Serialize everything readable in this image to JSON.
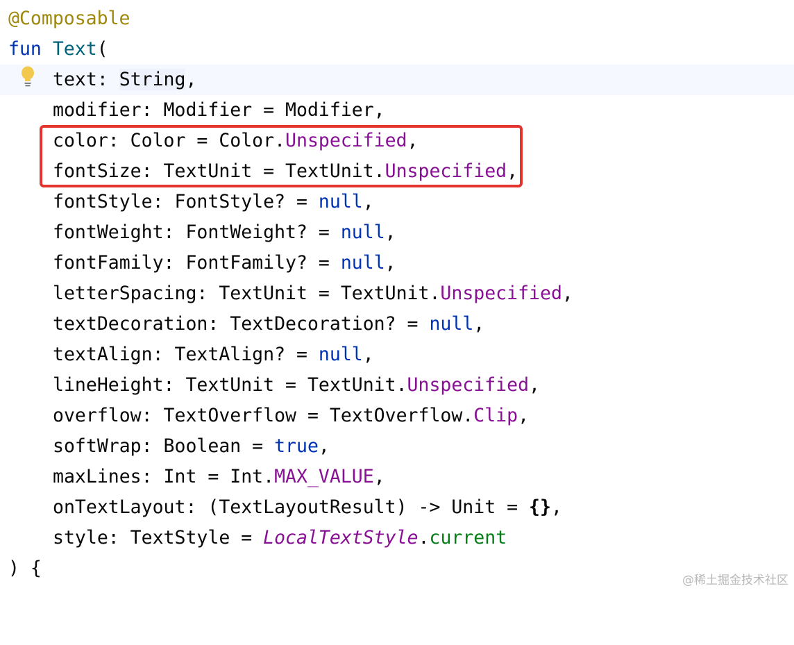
{
  "code": {
    "annotation": "@Composable",
    "keyword_fun": "fun",
    "fn_name": "Text",
    "open_paren": "(",
    "lines": [
      {
        "name": "text-param",
        "parts": [
          {
            "t": "text: ",
            "c": "param"
          },
          {
            "t": "String",
            "c": "param",
            "sel": true
          },
          {
            "t": ",",
            "c": "param"
          }
        ]
      },
      {
        "name": "modifier-param",
        "parts": [
          {
            "t": "modifier: Modifier = Modifier,",
            "c": "param"
          }
        ]
      },
      {
        "name": "color-param",
        "parts": [
          {
            "t": "color: Color = Color.",
            "c": "param"
          },
          {
            "t": "Unspecified",
            "c": "const"
          },
          {
            "t": ",",
            "c": "param"
          }
        ]
      },
      {
        "name": "fontsize-param",
        "parts": [
          {
            "t": "fontSize: TextUnit = TextUnit.",
            "c": "param"
          },
          {
            "t": "Unspecified",
            "c": "const"
          },
          {
            "t": ",",
            "c": "param"
          }
        ]
      },
      {
        "name": "fontstyle-param",
        "parts": [
          {
            "t": "fontStyle: FontStyle? = ",
            "c": "param"
          },
          {
            "t": "null",
            "c": "keyword"
          },
          {
            "t": ",",
            "c": "param"
          }
        ]
      },
      {
        "name": "fontweight-param",
        "parts": [
          {
            "t": "fontWeight: FontWeight? = ",
            "c": "param"
          },
          {
            "t": "null",
            "c": "keyword"
          },
          {
            "t": ",",
            "c": "param"
          }
        ]
      },
      {
        "name": "fontfamily-param",
        "parts": [
          {
            "t": "fontFamily: FontFamily? = ",
            "c": "param"
          },
          {
            "t": "null",
            "c": "keyword"
          },
          {
            "t": ",",
            "c": "param"
          }
        ]
      },
      {
        "name": "letterspacing-param",
        "parts": [
          {
            "t": "letterSpacing: TextUnit = TextUnit.",
            "c": "param"
          },
          {
            "t": "Unspecified",
            "c": "const"
          },
          {
            "t": ",",
            "c": "param"
          }
        ]
      },
      {
        "name": "textdecoration-param",
        "parts": [
          {
            "t": "textDecoration: TextDecoration? = ",
            "c": "param"
          },
          {
            "t": "null",
            "c": "keyword"
          },
          {
            "t": ",",
            "c": "param"
          }
        ]
      },
      {
        "name": "textalign-param",
        "parts": [
          {
            "t": "textAlign: TextAlign? = ",
            "c": "param"
          },
          {
            "t": "null",
            "c": "keyword"
          },
          {
            "t": ",",
            "c": "param"
          }
        ]
      },
      {
        "name": "lineheight-param",
        "parts": [
          {
            "t": "lineHeight: TextUnit = TextUnit.",
            "c": "param"
          },
          {
            "t": "Unspecified",
            "c": "const"
          },
          {
            "t": ",",
            "c": "param"
          }
        ]
      },
      {
        "name": "overflow-param",
        "parts": [
          {
            "t": "overflow: TextOverflow = TextOverflow.",
            "c": "param"
          },
          {
            "t": "Clip",
            "c": "const"
          },
          {
            "t": ",",
            "c": "param"
          }
        ]
      },
      {
        "name": "softwrap-param",
        "parts": [
          {
            "t": "softWrap: Boolean = ",
            "c": "param"
          },
          {
            "t": "true",
            "c": "keyword"
          },
          {
            "t": ",",
            "c": "param"
          }
        ]
      },
      {
        "name": "maxlines-param",
        "parts": [
          {
            "t": "maxLines: Int = Int.",
            "c": "param"
          },
          {
            "t": "MAX_VALUE",
            "c": "const"
          },
          {
            "t": ",",
            "c": "param"
          }
        ]
      },
      {
        "name": "ontextlayout-param",
        "parts": [
          {
            "t": "onTextLayout: (TextLayoutResult) -> Unit = ",
            "c": "param"
          },
          {
            "t": "{}",
            "c": "bold"
          },
          {
            "t": ",",
            "c": "param"
          }
        ]
      },
      {
        "name": "style-param",
        "parts": [
          {
            "t": "style: TextStyle = ",
            "c": "param"
          },
          {
            "t": "LocalTextStyle",
            "c": "italic"
          },
          {
            "t": ".",
            "c": "param"
          },
          {
            "t": "current",
            "c": "green"
          }
        ]
      }
    ],
    "closing": ") {"
  },
  "icons": {
    "gutter": "lightbulb-icon"
  },
  "watermark": "@稀土掘金技术社区",
  "colors": {
    "annotation": "#9e880d",
    "keyword": "#0033b3",
    "function": "#00627a",
    "constant": "#871094",
    "green": "#067d17",
    "highlight_border": "#e3342f"
  }
}
